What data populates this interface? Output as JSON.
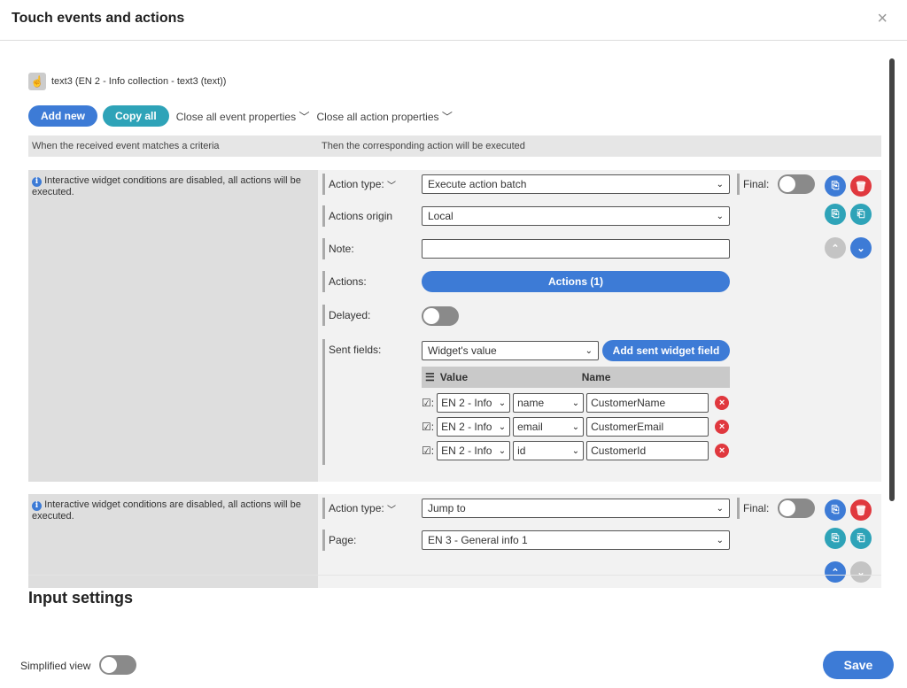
{
  "header": {
    "title": "Touch events and actions",
    "close_label": "×"
  },
  "widget": {
    "label": "text3 (EN 2 - Info collection - text3 (text))"
  },
  "toolbar": {
    "add_new": "Add new",
    "copy_all": "Copy all",
    "close_event": "Close all event properties",
    "close_action": "Close all action properties"
  },
  "columns": {
    "left": "When the received event matches a criteria",
    "right": "Then the corresponding action will be executed"
  },
  "panel1": {
    "info": "Interactive widget conditions are disabled, all actions will be executed.",
    "action_type_label": "Action type:",
    "action_type_value": "Execute action batch",
    "final_label": "Final:",
    "origin_label": "Actions origin",
    "origin_value": "Local",
    "note_label": "Note:",
    "note_value": "",
    "actions_label": "Actions:",
    "actions_button": "Actions (1)",
    "delayed_label": "Delayed:",
    "sent_label": "Sent fields:",
    "sent_select": "Widget's value",
    "add_sent": "Add sent widget field",
    "fields_header": {
      "value": "Value",
      "name": "Name"
    },
    "fields": [
      {
        "source": "EN 2 - Info",
        "field": "name",
        "name": "CustomerName"
      },
      {
        "source": "EN 2 - Info",
        "field": "email",
        "name": "CustomerEmail"
      },
      {
        "source": "EN 2 - Info",
        "field": "id",
        "name": "CustomerId"
      }
    ]
  },
  "panel2": {
    "info": "Interactive widget conditions are disabled, all actions will be executed.",
    "action_type_label": "Action type:",
    "action_type_value": "Jump to",
    "final_label": "Final:",
    "page_label": "Page:",
    "page_value": "EN 3 - General info 1"
  },
  "section": {
    "input_settings": "Input settings"
  },
  "footer": {
    "simplified_view": "Simplified view",
    "save": "Save"
  },
  "colors": {
    "primary": "#3d7bd6",
    "teal": "#2ea3b8",
    "danger": "#e0383e"
  }
}
